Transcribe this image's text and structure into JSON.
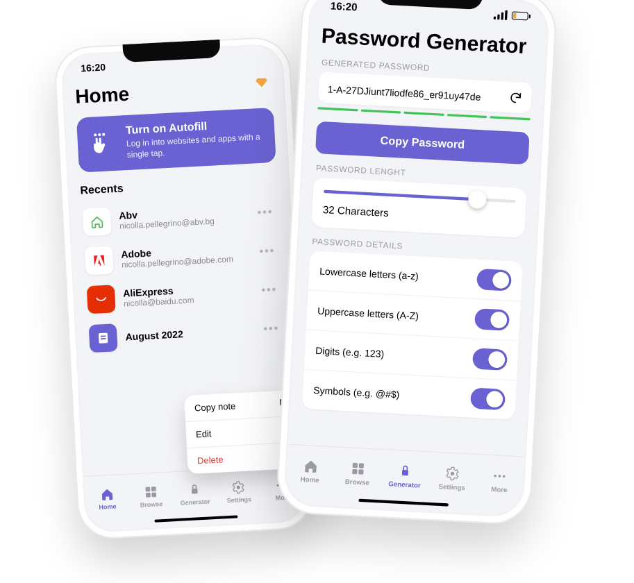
{
  "colors": {
    "accent": "#6a62d2",
    "danger": "#e03a2f",
    "green": "#42c457",
    "diamond": "#f2a53b"
  },
  "status": {
    "time": "16:20",
    "battery_pct": 20
  },
  "tabs": [
    {
      "label": "Home",
      "icon": "home-icon"
    },
    {
      "label": "Browse",
      "icon": "browse-icon"
    },
    {
      "label": "Generator",
      "icon": "generator-icon"
    },
    {
      "label": "Settings",
      "icon": "settings-icon"
    },
    {
      "label": "More",
      "icon": "more-icon"
    }
  ],
  "home": {
    "title": "Home",
    "promo": {
      "title": "Turn on Autofill",
      "subtitle": "Log in into websites and apps with a single tap."
    },
    "recents_label": "Recents",
    "active_tab": 0,
    "recents": [
      {
        "name": "Abv",
        "sub": "nicolla.pellegrino@abv.bg"
      },
      {
        "name": "Adobe",
        "sub": "nicolla.pellegrino@adobe.com"
      },
      {
        "name": "AliExpress",
        "sub": "nicolla@baidu.com"
      },
      {
        "name": "August 2022",
        "sub": ""
      }
    ],
    "context_menu": [
      {
        "label": "Copy note",
        "icon": "copy-icon"
      },
      {
        "label": "Edit",
        "icon": "pencil-icon"
      },
      {
        "label": "Delete",
        "icon": "trash-icon"
      }
    ]
  },
  "gen": {
    "title": "Password Generator",
    "section_generated": "GENERATED PASSWORD",
    "value": "1-A-27DJiunt7liodfe86_er91uy47de",
    "strength_segments": 5,
    "copy_label": "Copy Password",
    "section_length": "PASSWORD LENGHT",
    "length_value": 32,
    "length_text": "32 Characters",
    "length_max": 40,
    "section_details": "PASSWORD DETAILS",
    "active_tab": 2,
    "details": [
      {
        "label": "Lowercase letters (a-z)",
        "on": true
      },
      {
        "label": "Uppercase letters (A-Z)",
        "on": true
      },
      {
        "label": "Digits (e.g. 123)",
        "on": true
      },
      {
        "label": "Symbols (e.g. @#$)",
        "on": true
      }
    ]
  }
}
